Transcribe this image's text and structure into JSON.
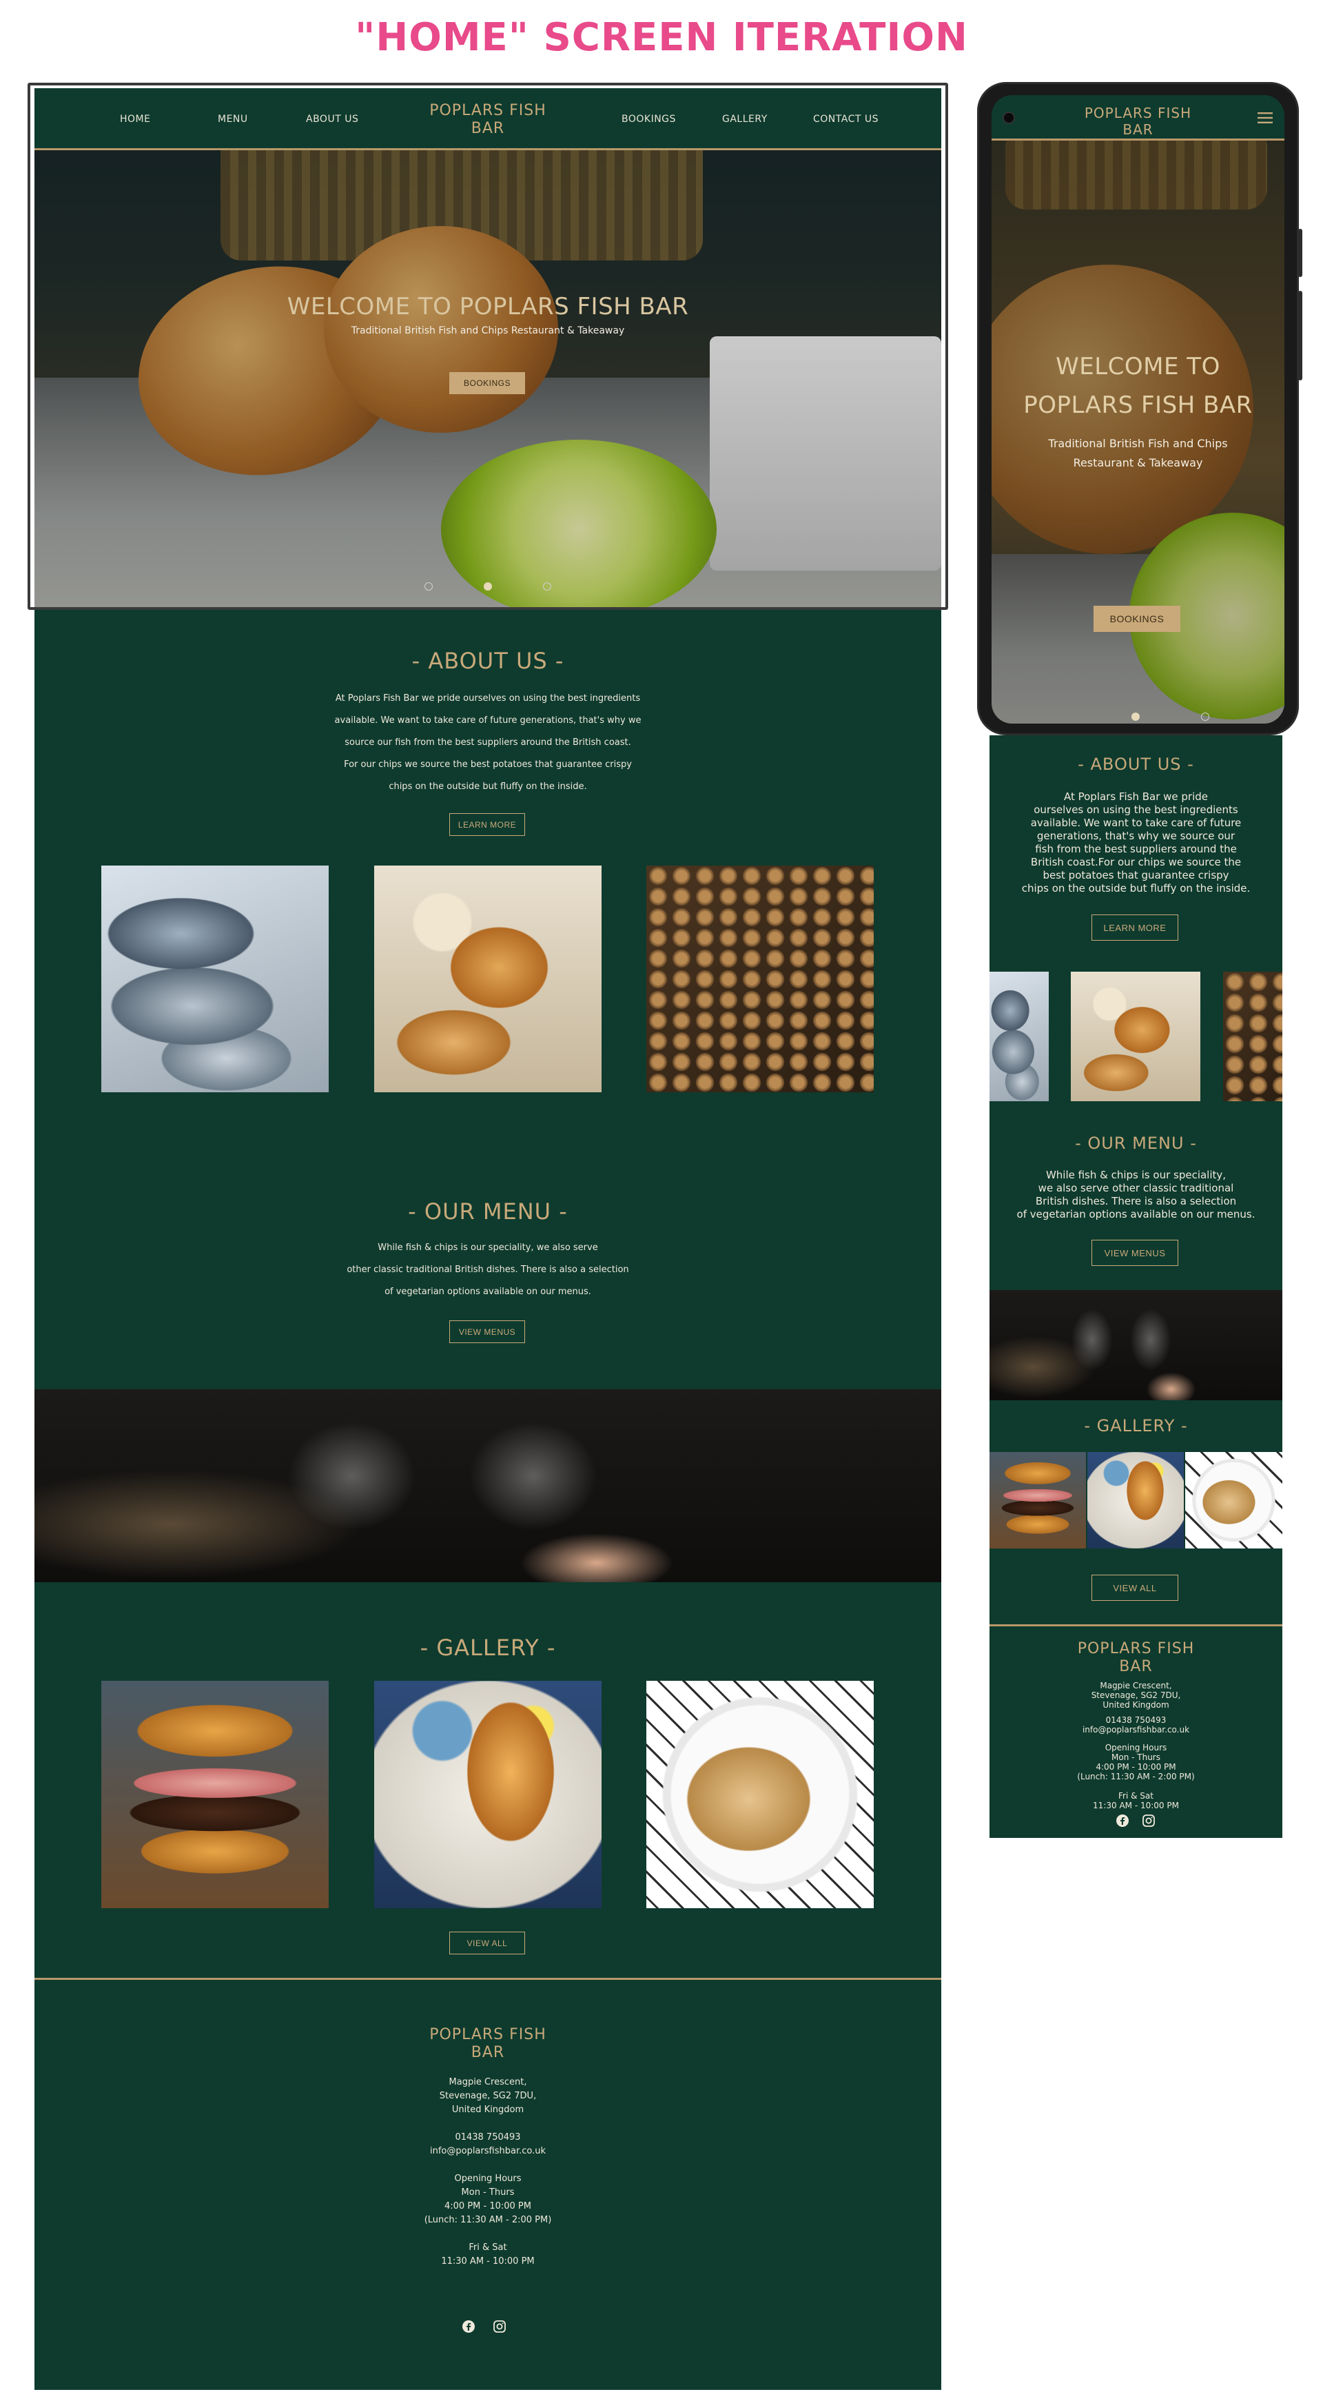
{
  "canvas_title": "\"HOME\" SCREEN ITERATION",
  "brand": {
    "line1": "POPLARS FISH",
    "line2": "BAR"
  },
  "nav": {
    "home": "HOME",
    "menu": "MENU",
    "about": "ABOUT US",
    "bookings": "BOOKINGS",
    "gallery": "GALLERY",
    "contact": "CONTACT US"
  },
  "hero": {
    "title": "WELCOME TO POPLARS FISH BAR",
    "subtitle": "Traditional British Fish and Chips Restaurant & Takeaway",
    "button": "BOOKINGS",
    "slides": 3,
    "active_slide": 2
  },
  "about": {
    "title": "- ABOUT US -",
    "lines": [
      "At Poplars Fish Bar we pride ourselves on using the best ingredients",
      "available. We want to take care of future generations, that's why we",
      "source our fish from the best suppliers around the British coast.",
      "For our chips we source the best potatoes that guarantee crispy",
      "chips on the outside but fluffy on the inside."
    ],
    "button": "LEARN MORE"
  },
  "menu_section": {
    "title": "- OUR MENU -",
    "lines": [
      "While fish & chips is our speciality, we also serve",
      "other classic traditional British dishes. There is also a selection",
      "of vegetarian options available on our menus."
    ],
    "button": "VIEW MENUS"
  },
  "gallery": {
    "title": "- GALLERY -",
    "button": "VIEW ALL"
  },
  "footer": {
    "address": [
      "Magpie Crescent,",
      "Stevenage, SG2 7DU,",
      "United Kingdom"
    ],
    "phone": "01438 750493",
    "email": "info@poplarsfishbar.co.uk",
    "hours_title": "Opening Hours",
    "hours_1_days": "Mon - Thurs",
    "hours_1_time": "4:00 PM - 10:00 PM",
    "hours_1_lunch": "(Lunch: 11:30 AM - 2:00 PM)",
    "hours_2_days": "Fri & Sat",
    "hours_2_time": "11:30 AM - 10:00 PM"
  },
  "mobile": {
    "hero_title": [
      "WELCOME TO",
      "POPLARS FISH BAR"
    ],
    "hero_sub": [
      "Traditional British Fish and Chips",
      "Restaurant & Takeaway"
    ],
    "about_lines": [
      "At Poplars Fish Bar we pride",
      "ourselves on using the best ingredients",
      "available. We want to take care of future",
      "generations, that's why we source our",
      "fish from the best suppliers around the",
      "British coast.For our chips we source the",
      "best potatoes that guarantee crispy",
      "chips on the outside but fluffy on the inside."
    ],
    "menu_lines": [
      "While fish & chips is our speciality,",
      "we also serve other classic traditional",
      "British dishes. There is also a selection",
      "of vegetarian options available on our menus."
    ],
    "footer_address": [
      "Magpie Crescent,",
      "Stevenage, SG2 7DU,",
      "United Kingdom"
    ]
  },
  "colors": {
    "background": "#0e3b2e",
    "gold": "#c9a97a",
    "accent_title": "#e84a8a"
  }
}
